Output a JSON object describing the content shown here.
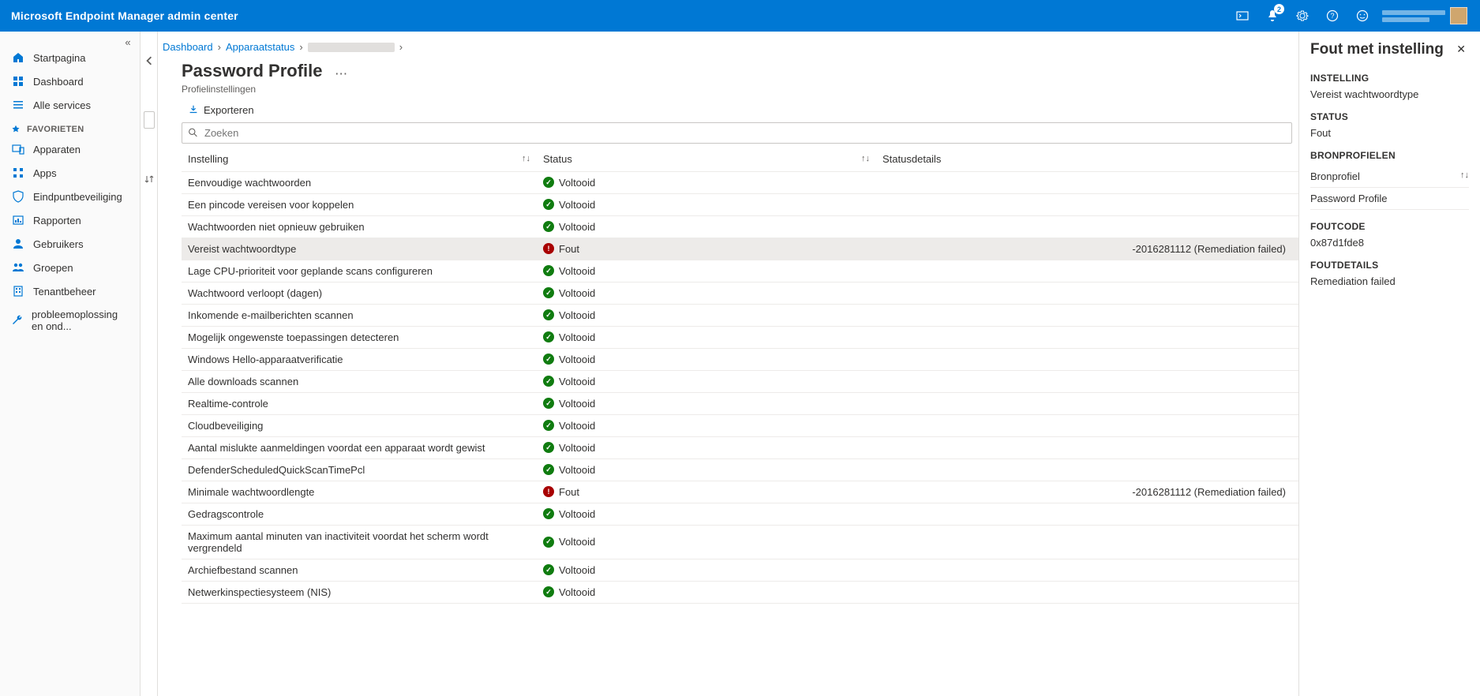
{
  "topbar": {
    "title": "Microsoft Endpoint Manager admin center",
    "notification_count": "2"
  },
  "sidebar": {
    "items": [
      {
        "icon": "home",
        "label": "Startpagina"
      },
      {
        "icon": "dashboard",
        "label": "Dashboard"
      },
      {
        "icon": "list",
        "label": "Alle services"
      }
    ],
    "favorites_label": "FAVORIETEN",
    "fav_items": [
      {
        "icon": "devices",
        "label": "Apparaten"
      },
      {
        "icon": "apps",
        "label": "Apps"
      },
      {
        "icon": "shield",
        "label": "Eindpuntbeveiliging"
      },
      {
        "icon": "report",
        "label": "Rapporten"
      },
      {
        "icon": "users",
        "label": "Gebruikers"
      },
      {
        "icon": "groups",
        "label": "Groepen"
      },
      {
        "icon": "tenant",
        "label": "Tenantbeheer"
      },
      {
        "icon": "wrench",
        "label": "probleemoplossing en ond..."
      }
    ]
  },
  "breadcrumb": {
    "items": [
      "Dashboard",
      "Apparaatstatus"
    ]
  },
  "header": {
    "title": "Password Profile",
    "subtitle": "Profielinstellingen"
  },
  "toolbar": {
    "export_label": "Exporteren"
  },
  "search": {
    "placeholder": "Zoeken"
  },
  "columns": {
    "setting": "Instelling",
    "status": "Status",
    "details": "Statusdetails",
    "sort_glyph": "↑↓"
  },
  "status_labels": {
    "ok": "Voltooid",
    "err": "Fout"
  },
  "rows": [
    {
      "name": "Eenvoudige wachtwoorden",
      "status": "ok",
      "details": ""
    },
    {
      "name": "Een pincode vereisen voor koppelen",
      "status": "ok",
      "details": ""
    },
    {
      "name": "Wachtwoorden niet opnieuw gebruiken",
      "status": "ok",
      "details": ""
    },
    {
      "name": "Vereist wachtwoordtype",
      "status": "err",
      "details": "-2016281112 (Remediation failed)",
      "selected": true
    },
    {
      "name": "Lage CPU-prioriteit voor geplande scans configureren",
      "status": "ok",
      "details": ""
    },
    {
      "name": "Wachtwoord verloopt (dagen)",
      "status": "ok",
      "details": ""
    },
    {
      "name": "Inkomende e-mailberichten scannen",
      "status": "ok",
      "details": ""
    },
    {
      "name": "Mogelijk ongewenste toepassingen detecteren",
      "status": "ok",
      "details": ""
    },
    {
      "name": "Windows Hello-apparaatverificatie",
      "status": "ok",
      "details": ""
    },
    {
      "name": "Alle downloads scannen",
      "status": "ok",
      "details": ""
    },
    {
      "name": "Realtime-controle",
      "status": "ok",
      "details": ""
    },
    {
      "name": "Cloudbeveiliging",
      "status": "ok",
      "details": ""
    },
    {
      "name": "Aantal mislukte aanmeldingen voordat een apparaat wordt gewist",
      "status": "ok",
      "details": ""
    },
    {
      "name": "DefenderScheduledQuickScanTimePcl",
      "status": "ok",
      "details": ""
    },
    {
      "name": "Minimale wachtwoordlengte",
      "status": "err",
      "details": "-2016281112 (Remediation failed)"
    },
    {
      "name": "Gedragscontrole",
      "status": "ok",
      "details": ""
    },
    {
      "name": "Maximum aantal minuten van inactiviteit voordat het scherm wordt vergrendeld",
      "status": "ok",
      "details": ""
    },
    {
      "name": "Archiefbestand scannen",
      "status": "ok",
      "details": ""
    },
    {
      "name": "Netwerkinspectiesysteem (NIS)",
      "status": "ok",
      "details": ""
    }
  ],
  "detail": {
    "title": "Fout met instelling",
    "sections": {
      "instelling_h": "INSTELLING",
      "instelling_v": "Vereist wachtwoordtype",
      "status_h": "STATUS",
      "status_v": "Fout",
      "bronprofielen_h": "BRONPROFIELEN",
      "bronprofiel_col": "Bronprofiel",
      "bronprofiel_val": "Password Profile",
      "foutcode_h": "FOUTCODE",
      "foutcode_v": "0x87d1fde8",
      "foutdetails_h": "FOUTDETAILS",
      "foutdetails_v": "Remediation failed"
    }
  }
}
